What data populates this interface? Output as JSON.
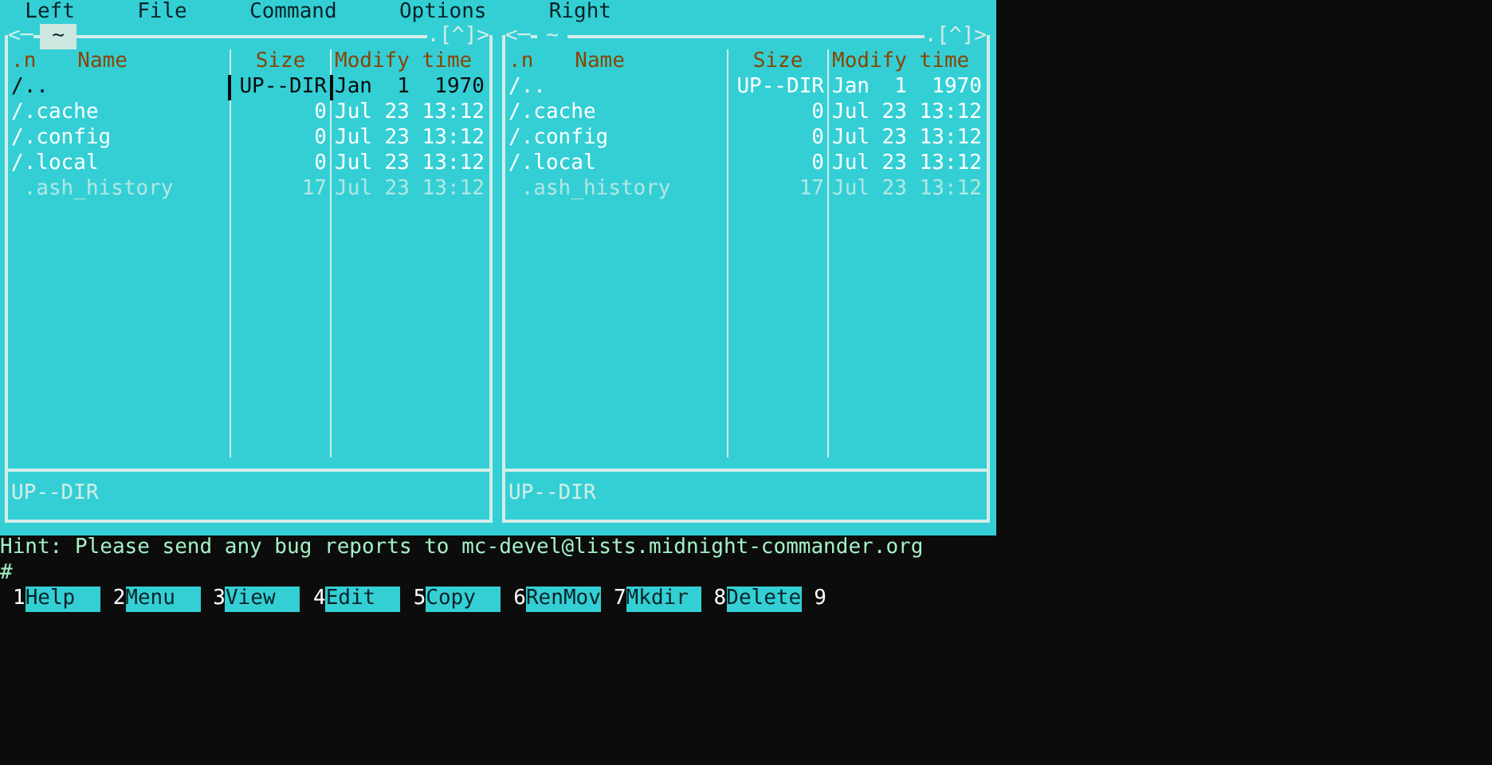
{
  "menu": [
    {
      "label": "Left"
    },
    {
      "label": "File"
    },
    {
      "label": "Command"
    },
    {
      "label": "Options"
    },
    {
      "label": "Right"
    }
  ],
  "panels": [
    {
      "active": true,
      "left_mark": "<─",
      "path": "~",
      "right_mark": ".[^]>",
      "columns": [
        ".n",
        "Name",
        "Size",
        "Modify time"
      ],
      "rows": [
        {
          "name": "/..",
          "size": "UP--DIR",
          "time": "Jan  1  1970",
          "kind": "dir",
          "selected": true
        },
        {
          "name": "/.cache",
          "size": "0",
          "time": "Jul 23 13:12",
          "kind": "dir",
          "selected": false
        },
        {
          "name": "/.config",
          "size": "0",
          "time": "Jul 23 13:12",
          "kind": "dir",
          "selected": false
        },
        {
          "name": "/.local",
          "size": "0",
          "time": "Jul 23 13:12",
          "kind": "dir",
          "selected": false
        },
        {
          "name": " .ash_history",
          "size": "17",
          "time": "Jul 23 13:12",
          "kind": "file",
          "selected": false
        }
      ],
      "status": "UP--DIR"
    },
    {
      "active": false,
      "left_mark": "<─",
      "path": "~",
      "right_mark": ".[^]>",
      "columns": [
        ".n",
        "Name",
        "Size",
        "Modify time"
      ],
      "rows": [
        {
          "name": "/..",
          "size": "UP--DIR",
          "time": "Jan  1  1970",
          "kind": "dir",
          "selected": false
        },
        {
          "name": "/.cache",
          "size": "0",
          "time": "Jul 23 13:12",
          "kind": "dir",
          "selected": false
        },
        {
          "name": "/.config",
          "size": "0",
          "time": "Jul 23 13:12",
          "kind": "dir",
          "selected": false
        },
        {
          "name": "/.local",
          "size": "0",
          "time": "Jul 23 13:12",
          "kind": "dir",
          "selected": false
        },
        {
          "name": " .ash_history",
          "size": "17",
          "time": "Jul 23 13:12",
          "kind": "file",
          "selected": false
        }
      ],
      "status": "UP--DIR"
    }
  ],
  "hint": "Hint: Please send any bug reports to mc-devel@lists.midnight-commander.org",
  "prompt": "#",
  "function_keys": [
    {
      "number": "1",
      "label": "Help"
    },
    {
      "number": "2",
      "label": "Menu"
    },
    {
      "number": "3",
      "label": "View"
    },
    {
      "number": "4",
      "label": "Edit"
    },
    {
      "number": "5",
      "label": "Copy"
    },
    {
      "number": "6",
      "label": "RenMov"
    },
    {
      "number": "7",
      "label": "Mkdir"
    },
    {
      "number": "8",
      "label": "Delete"
    },
    {
      "number": "9"
    }
  ]
}
